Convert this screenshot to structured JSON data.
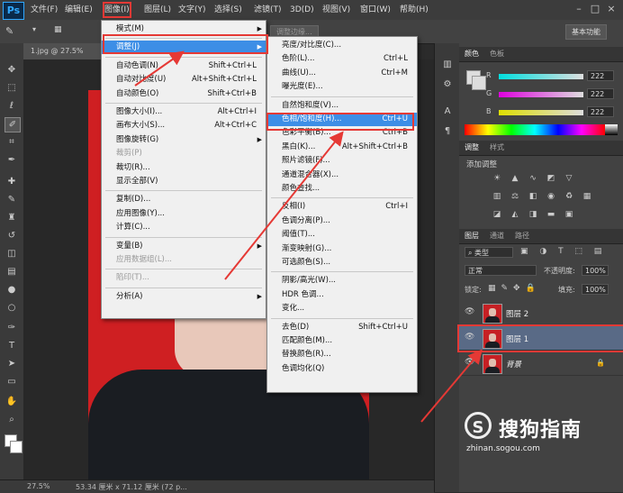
{
  "app": {
    "logo": "Ps"
  },
  "menubar": {
    "items": [
      "文件(F)",
      "编辑(E)",
      "图像(I)",
      "图层(L)",
      "文字(Y)",
      "选择(S)",
      "滤镜(T)",
      "3D(D)",
      "视图(V)",
      "窗口(W)",
      "帮助(H)"
    ],
    "active": "图像(I)"
  },
  "window_controls": [
    "–",
    "□",
    "×"
  ],
  "options_bar": {
    "mode3d": "调整边缘...",
    "workspace": "基本功能"
  },
  "document": {
    "tab": "1.jpg @ 27.5% (图...",
    "zoom": "27.5%",
    "info": "53.34 厘米 x 71.12 厘米 (72 p..."
  },
  "image_menu": [
    {
      "label": "模式(M)",
      "sub": true
    },
    {
      "sep": true
    },
    {
      "label": "调整(J)",
      "sub": true,
      "hl": true
    },
    {
      "sep": true
    },
    {
      "label": "自动色调(N)",
      "shortcut": "Shift+Ctrl+L"
    },
    {
      "label": "自动对比度(U)",
      "shortcut": "Alt+Shift+Ctrl+L"
    },
    {
      "label": "自动颜色(O)",
      "shortcut": "Shift+Ctrl+B"
    },
    {
      "sep": true
    },
    {
      "label": "图像大小(I)...",
      "shortcut": "Alt+Ctrl+I"
    },
    {
      "label": "画布大小(S)...",
      "shortcut": "Alt+Ctrl+C"
    },
    {
      "label": "图像旋转(G)",
      "sub": true
    },
    {
      "label": "裁剪(P)",
      "disabled": true
    },
    {
      "label": "裁切(R)..."
    },
    {
      "label": "显示全部(V)"
    },
    {
      "sep": true
    },
    {
      "label": "复制(D)..."
    },
    {
      "label": "应用图像(Y)..."
    },
    {
      "label": "计算(C)..."
    },
    {
      "sep": true
    },
    {
      "label": "变量(B)",
      "sub": true
    },
    {
      "label": "应用数据组(L)...",
      "disabled": true
    },
    {
      "sep": true
    },
    {
      "label": "陷印(T)...",
      "disabled": true
    },
    {
      "sep": true
    },
    {
      "label": "分析(A)",
      "sub": true
    }
  ],
  "adjust_menu": [
    {
      "label": "亮度/对比度(C)..."
    },
    {
      "label": "色阶(L)...",
      "shortcut": "Ctrl+L"
    },
    {
      "label": "曲线(U)...",
      "shortcut": "Ctrl+M"
    },
    {
      "label": "曝光度(E)..."
    },
    {
      "sep": true
    },
    {
      "label": "自然饱和度(V)..."
    },
    {
      "label": "色相/饱和度(H)...",
      "shortcut": "Ctrl+U",
      "hl": true
    },
    {
      "label": "色彩平衡(B)...",
      "shortcut": "Ctrl+B"
    },
    {
      "label": "黑白(K)...",
      "shortcut": "Alt+Shift+Ctrl+B"
    },
    {
      "label": "照片滤镜(F)..."
    },
    {
      "label": "通道混合器(X)..."
    },
    {
      "label": "颜色查找..."
    },
    {
      "sep": true
    },
    {
      "label": "反相(I)",
      "shortcut": "Ctrl+I"
    },
    {
      "label": "色调分离(P)..."
    },
    {
      "label": "阈值(T)..."
    },
    {
      "label": "渐变映射(G)..."
    },
    {
      "label": "可选颜色(S)..."
    },
    {
      "sep": true
    },
    {
      "label": "阴影/高光(W)..."
    },
    {
      "label": "HDR 色调..."
    },
    {
      "label": "变化..."
    },
    {
      "sep": true
    },
    {
      "label": "去色(D)",
      "shortcut": "Shift+Ctrl+U"
    },
    {
      "label": "匹配颜色(M)..."
    },
    {
      "label": "替换颜色(R)..."
    },
    {
      "label": "色调均化(Q)"
    }
  ],
  "color_panel": {
    "tabs": [
      "颜色",
      "色板"
    ],
    "r_label": "R",
    "g_label": "G",
    "b_label": "B",
    "r": "222",
    "g": "222",
    "b": "222"
  },
  "adjust_panel": {
    "tabs": [
      "调整",
      "样式"
    ],
    "title": "添加调整"
  },
  "layers_panel": {
    "tabs": [
      "图层",
      "通道",
      "路径"
    ],
    "kind": "类型",
    "blend": "正常",
    "opacity_label": "不透明度:",
    "opacity": "100%",
    "lock_label": "锁定:",
    "fill_label": "填充:",
    "fill": "100%",
    "layers": [
      "图层 2",
      "图层 1",
      "背景"
    ]
  },
  "watermark": {
    "symbol": "S",
    "text": "搜狗指南",
    "url": "zhinan.sogou.com"
  },
  "colors": {
    "highlight": "#3d8ee6",
    "annotation": "#e53935"
  }
}
